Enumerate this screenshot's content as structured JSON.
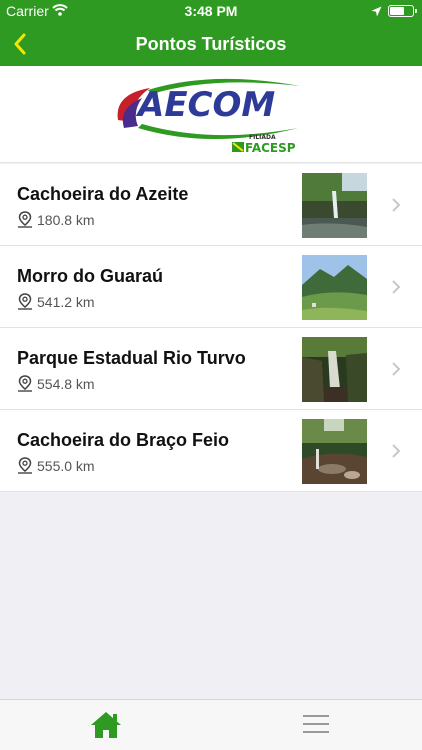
{
  "status_bar": {
    "carrier": "Carrier",
    "time": "3:48 PM",
    "battery_level": 0.7
  },
  "header": {
    "title": "Pontos Turísticos",
    "back_icon": "chevron-left-icon"
  },
  "logo": {
    "brand": "AECOM",
    "tagline": "FILIADA",
    "partner": "FACESP"
  },
  "places": [
    {
      "name": "Cachoeira do Azeite",
      "distance": "180.8 km"
    },
    {
      "name": "Morro do Guaraú",
      "distance": "541.2 km"
    },
    {
      "name": "Parque Estadual Rio Turvo",
      "distance": "554.8 km"
    },
    {
      "name": "Cachoeira do Braço Feio",
      "distance": "555.0 km"
    }
  ],
  "tab_bar": {
    "items": [
      {
        "icon": "home-icon",
        "active": true
      },
      {
        "icon": "menu-icon",
        "active": false
      }
    ]
  },
  "colors": {
    "primary": "#2f9a21",
    "accent": "#f3e600"
  }
}
